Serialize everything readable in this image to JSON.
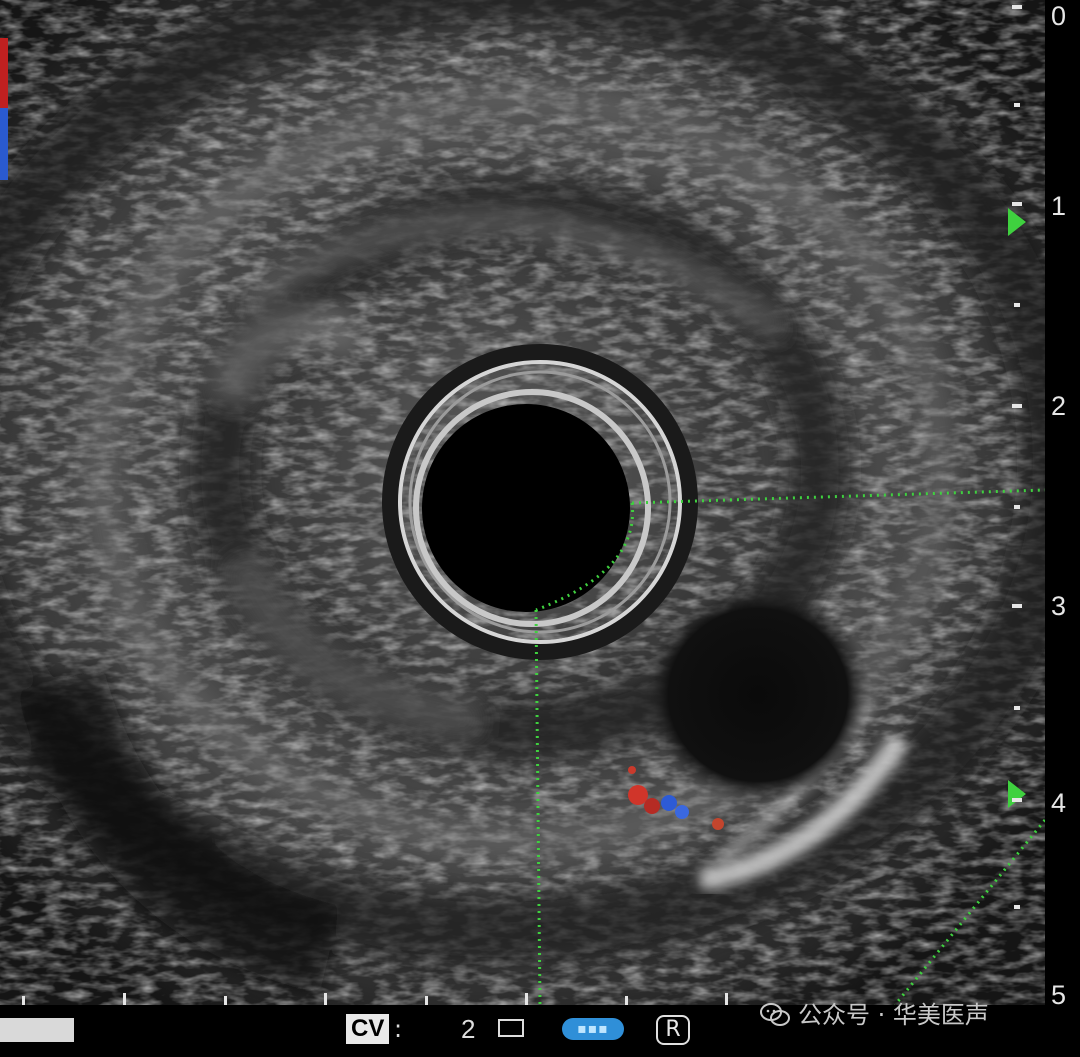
{
  "scan": {
    "depth_scale": {
      "labels": [
        "0",
        "1",
        "2",
        "3",
        "4",
        "5"
      ]
    },
    "status": {
      "cv_label": "CV",
      "cv_separator": ":",
      "cv_value": "2",
      "mode_icon": "color-doppler-icon",
      "r_label": "R"
    },
    "colors": {
      "background": "#000000",
      "tissue": "#8a8a8a",
      "caliper": "#3fd13f",
      "doppler_red": "#d0352a",
      "doppler_blue": "#2d5bd6",
      "accent_blue": "#2f8fd8"
    }
  },
  "watermark": {
    "text": "公众号 · 华美医声",
    "icon": "wechat-icon"
  }
}
